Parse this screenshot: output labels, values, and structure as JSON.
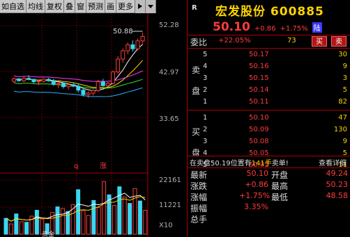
{
  "toolbar": {
    "items": [
      "如自选",
      "均线",
      "复权",
      "叠",
      "窗",
      "预测",
      "画",
      "更多"
    ],
    "arrow_icon": "play-right-icon",
    "menu_icon": "dropdown-icon"
  },
  "chart": {
    "axis": {
      "top": "52.28",
      "mid": "42.97",
      "low": "33.65"
    },
    "annot_max": "50.88",
    "marks": {
      "q": "q",
      "zhang": "涨"
    },
    "volume_axis": {
      "top": "22161",
      "mid": "11221",
      "unit": "X10"
    },
    "bottom_strip": "资金",
    "colors": {
      "up": "#ff3b3b",
      "down": "#3ad6f0",
      "ma5": "#ffffff",
      "ma10": "#ffd400",
      "ma20": "#ff3bff",
      "ma30": "#3adc3a",
      "ma60": "#2ab0ff"
    }
  },
  "chart_data": {
    "type": "candlestick",
    "ylim": [
      33.65,
      52.28
    ],
    "ticks": [
      "52.28",
      "42.97",
      "33.65"
    ],
    "candles": [
      [
        41.0,
        41.8,
        40.6,
        41.5
      ],
      [
        41.5,
        41.6,
        40.9,
        41.1
      ],
      [
        41.1,
        41.9,
        40.8,
        41.6
      ],
      [
        41.6,
        42.2,
        41.2,
        41.4
      ],
      [
        41.4,
        41.5,
        40.6,
        40.9
      ],
      [
        40.9,
        41.3,
        40.2,
        41.0
      ],
      [
        41.0,
        41.6,
        40.7,
        41.4
      ],
      [
        41.4,
        41.7,
        40.9,
        41.1
      ],
      [
        41.1,
        41.5,
        40.1,
        40.4
      ],
      [
        40.4,
        40.9,
        39.6,
        40.6
      ],
      [
        40.6,
        40.8,
        39.5,
        39.9
      ],
      [
        39.9,
        40.5,
        39.3,
        40.3
      ],
      [
        40.3,
        40.7,
        39.8,
        40.0
      ],
      [
        40.0,
        40.4,
        38.7,
        39.2
      ],
      [
        39.2,
        39.6,
        37.9,
        38.3
      ],
      [
        38.3,
        38.9,
        37.6,
        38.6
      ],
      [
        38.6,
        39.4,
        38.1,
        39.1
      ],
      [
        39.1,
        41.3,
        38.8,
        40.9
      ],
      [
        40.9,
        41.5,
        39.9,
        40.1
      ],
      [
        40.1,
        40.9,
        39.7,
        40.6
      ],
      [
        40.6,
        43.2,
        40.3,
        42.9
      ],
      [
        42.9,
        46.1,
        42.5,
        45.5
      ],
      [
        45.5,
        47.7,
        44.8,
        47.2
      ],
      [
        47.2,
        48.9,
        46.5,
        48.4
      ],
      [
        48.4,
        49.3,
        47.0,
        47.6
      ],
      [
        47.6,
        49.7,
        47.3,
        49.2
      ],
      [
        49.2,
        50.88,
        48.6,
        50.1
      ]
    ],
    "volumes": [
      6500,
      4200,
      8300,
      5100,
      4900,
      7400,
      9800,
      6200,
      4300,
      8900,
      11200,
      10500,
      9300,
      12100,
      18200,
      9600,
      7700,
      13800,
      10900,
      21500,
      16100,
      11800,
      19400,
      15200,
      12600,
      18700,
      13600,
      9800
    ],
    "volume_colors": [
      "c",
      "r",
      "c",
      "r",
      "c",
      "r",
      "c",
      "r",
      "c",
      "r",
      "c",
      "r",
      "c",
      "r",
      "c",
      "r",
      "r",
      "c",
      "r",
      "r",
      "c",
      "r",
      "c",
      "r",
      "c",
      "r",
      "c",
      "r"
    ]
  },
  "panel": {
    "r_label": "R",
    "title": "宏发股份 600885",
    "price": "50.10",
    "change": "+0.86",
    "pct": "+1.75%",
    "badge": "陆",
    "weibi_label": "委比",
    "weibi_pct": "+22.05%",
    "weibi_num": "73",
    "buy_btn": "买",
    "sell_btn": "卖",
    "sell_label_a": "卖",
    "sell_label_b": "盘",
    "buy_label_a": "买",
    "buy_label_b": "盘",
    "sell": [
      {
        "lvl": "5",
        "price": "50.17",
        "vol": "30"
      },
      {
        "lvl": "4",
        "price": "50.16",
        "vol": "9"
      },
      {
        "lvl": "3",
        "price": "50.15",
        "vol": "3"
      },
      {
        "lvl": "2",
        "price": "50.14",
        "vol": "5"
      },
      {
        "lvl": "1",
        "price": "50.11",
        "vol": "82"
      }
    ],
    "buy": [
      {
        "lvl": "1",
        "price": "50.10",
        "vol": "47"
      },
      {
        "lvl": "2",
        "price": "50.09",
        "vol": "130"
      },
      {
        "lvl": "3",
        "price": "50.08",
        "vol": "9"
      },
      {
        "lvl": "4",
        "price": "50.05",
        "vol": "5"
      },
      {
        "lvl": "5",
        "price": "50.02",
        "vol": "11"
      }
    ],
    "trade_prefix": "在卖盘50.19位置有",
    "trade_vol": "141手",
    "trade_suffix": "卖单!",
    "detail": "查看详细",
    "stats": [
      {
        "l1": "最新",
        "v1": "50.10",
        "l2": "开盘",
        "v2": "49.24"
      },
      {
        "l1": "涨跌",
        "v1": "+0.86",
        "l2": "最高",
        "v2": "50.23"
      },
      {
        "l1": "涨幅",
        "v1": "+1.75%",
        "l2": "最低",
        "v2": "48.58"
      },
      {
        "l1": "振幅",
        "v1": "3.35%",
        "l2": "",
        "v2": ""
      },
      {
        "l1": "总手",
        "v1": "",
        "l2": "",
        "v2": ""
      }
    ]
  }
}
